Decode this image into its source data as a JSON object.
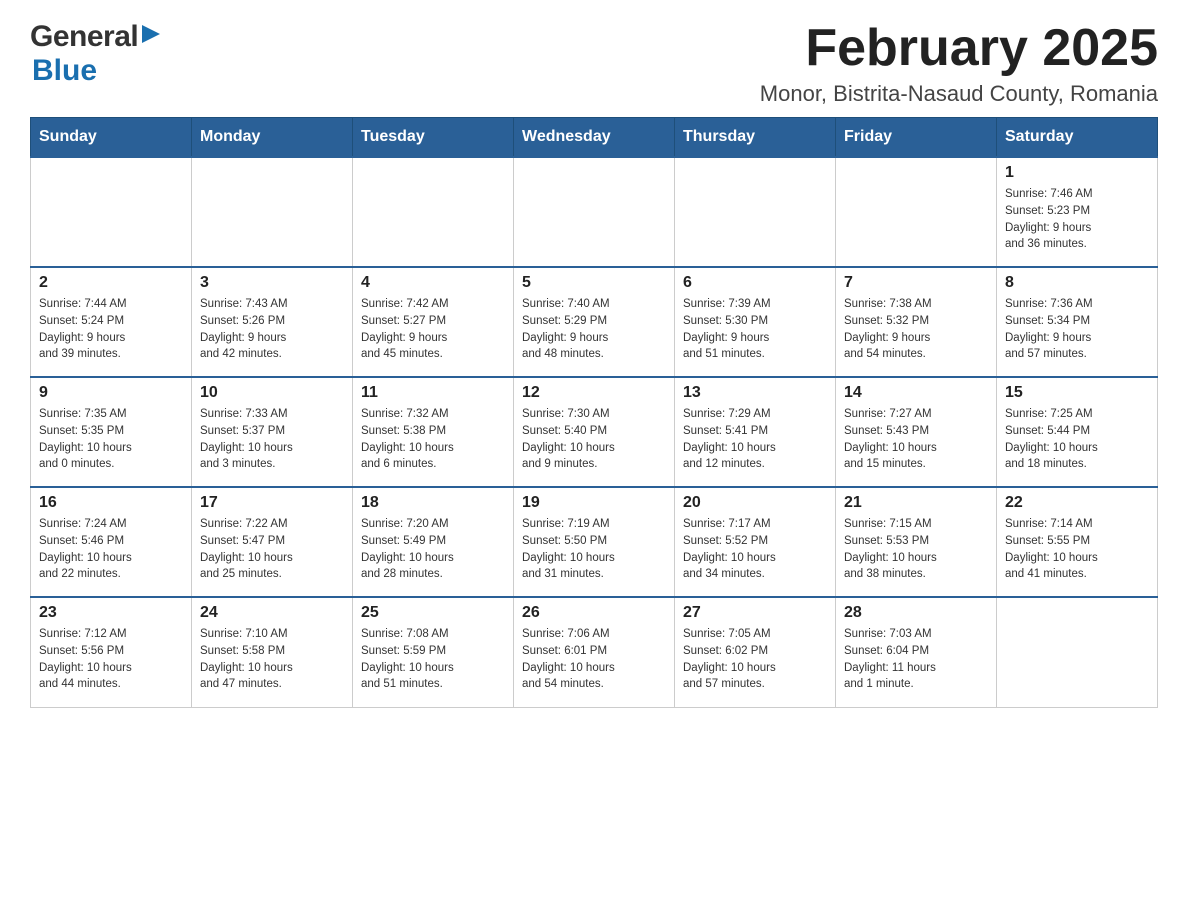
{
  "header": {
    "logo": {
      "general": "General",
      "blue": "Blue"
    },
    "title": "February 2025",
    "location": "Monor, Bistrita-Nasaud County, Romania"
  },
  "calendar": {
    "weekdays": [
      "Sunday",
      "Monday",
      "Tuesday",
      "Wednesday",
      "Thursday",
      "Friday",
      "Saturday"
    ],
    "weeks": [
      [
        {
          "day": "",
          "info": ""
        },
        {
          "day": "",
          "info": ""
        },
        {
          "day": "",
          "info": ""
        },
        {
          "day": "",
          "info": ""
        },
        {
          "day": "",
          "info": ""
        },
        {
          "day": "",
          "info": ""
        },
        {
          "day": "1",
          "info": "Sunrise: 7:46 AM\nSunset: 5:23 PM\nDaylight: 9 hours\nand 36 minutes."
        }
      ],
      [
        {
          "day": "2",
          "info": "Sunrise: 7:44 AM\nSunset: 5:24 PM\nDaylight: 9 hours\nand 39 minutes."
        },
        {
          "day": "3",
          "info": "Sunrise: 7:43 AM\nSunset: 5:26 PM\nDaylight: 9 hours\nand 42 minutes."
        },
        {
          "day": "4",
          "info": "Sunrise: 7:42 AM\nSunset: 5:27 PM\nDaylight: 9 hours\nand 45 minutes."
        },
        {
          "day": "5",
          "info": "Sunrise: 7:40 AM\nSunset: 5:29 PM\nDaylight: 9 hours\nand 48 minutes."
        },
        {
          "day": "6",
          "info": "Sunrise: 7:39 AM\nSunset: 5:30 PM\nDaylight: 9 hours\nand 51 minutes."
        },
        {
          "day": "7",
          "info": "Sunrise: 7:38 AM\nSunset: 5:32 PM\nDaylight: 9 hours\nand 54 minutes."
        },
        {
          "day": "8",
          "info": "Sunrise: 7:36 AM\nSunset: 5:34 PM\nDaylight: 9 hours\nand 57 minutes."
        }
      ],
      [
        {
          "day": "9",
          "info": "Sunrise: 7:35 AM\nSunset: 5:35 PM\nDaylight: 10 hours\nand 0 minutes."
        },
        {
          "day": "10",
          "info": "Sunrise: 7:33 AM\nSunset: 5:37 PM\nDaylight: 10 hours\nand 3 minutes."
        },
        {
          "day": "11",
          "info": "Sunrise: 7:32 AM\nSunset: 5:38 PM\nDaylight: 10 hours\nand 6 minutes."
        },
        {
          "day": "12",
          "info": "Sunrise: 7:30 AM\nSunset: 5:40 PM\nDaylight: 10 hours\nand 9 minutes."
        },
        {
          "day": "13",
          "info": "Sunrise: 7:29 AM\nSunset: 5:41 PM\nDaylight: 10 hours\nand 12 minutes."
        },
        {
          "day": "14",
          "info": "Sunrise: 7:27 AM\nSunset: 5:43 PM\nDaylight: 10 hours\nand 15 minutes."
        },
        {
          "day": "15",
          "info": "Sunrise: 7:25 AM\nSunset: 5:44 PM\nDaylight: 10 hours\nand 18 minutes."
        }
      ],
      [
        {
          "day": "16",
          "info": "Sunrise: 7:24 AM\nSunset: 5:46 PM\nDaylight: 10 hours\nand 22 minutes."
        },
        {
          "day": "17",
          "info": "Sunrise: 7:22 AM\nSunset: 5:47 PM\nDaylight: 10 hours\nand 25 minutes."
        },
        {
          "day": "18",
          "info": "Sunrise: 7:20 AM\nSunset: 5:49 PM\nDaylight: 10 hours\nand 28 minutes."
        },
        {
          "day": "19",
          "info": "Sunrise: 7:19 AM\nSunset: 5:50 PM\nDaylight: 10 hours\nand 31 minutes."
        },
        {
          "day": "20",
          "info": "Sunrise: 7:17 AM\nSunset: 5:52 PM\nDaylight: 10 hours\nand 34 minutes."
        },
        {
          "day": "21",
          "info": "Sunrise: 7:15 AM\nSunset: 5:53 PM\nDaylight: 10 hours\nand 38 minutes."
        },
        {
          "day": "22",
          "info": "Sunrise: 7:14 AM\nSunset: 5:55 PM\nDaylight: 10 hours\nand 41 minutes."
        }
      ],
      [
        {
          "day": "23",
          "info": "Sunrise: 7:12 AM\nSunset: 5:56 PM\nDaylight: 10 hours\nand 44 minutes."
        },
        {
          "day": "24",
          "info": "Sunrise: 7:10 AM\nSunset: 5:58 PM\nDaylight: 10 hours\nand 47 minutes."
        },
        {
          "day": "25",
          "info": "Sunrise: 7:08 AM\nSunset: 5:59 PM\nDaylight: 10 hours\nand 51 minutes."
        },
        {
          "day": "26",
          "info": "Sunrise: 7:06 AM\nSunset: 6:01 PM\nDaylight: 10 hours\nand 54 minutes."
        },
        {
          "day": "27",
          "info": "Sunrise: 7:05 AM\nSunset: 6:02 PM\nDaylight: 10 hours\nand 57 minutes."
        },
        {
          "day": "28",
          "info": "Sunrise: 7:03 AM\nSunset: 6:04 PM\nDaylight: 11 hours\nand 1 minute."
        },
        {
          "day": "",
          "info": ""
        }
      ]
    ]
  }
}
